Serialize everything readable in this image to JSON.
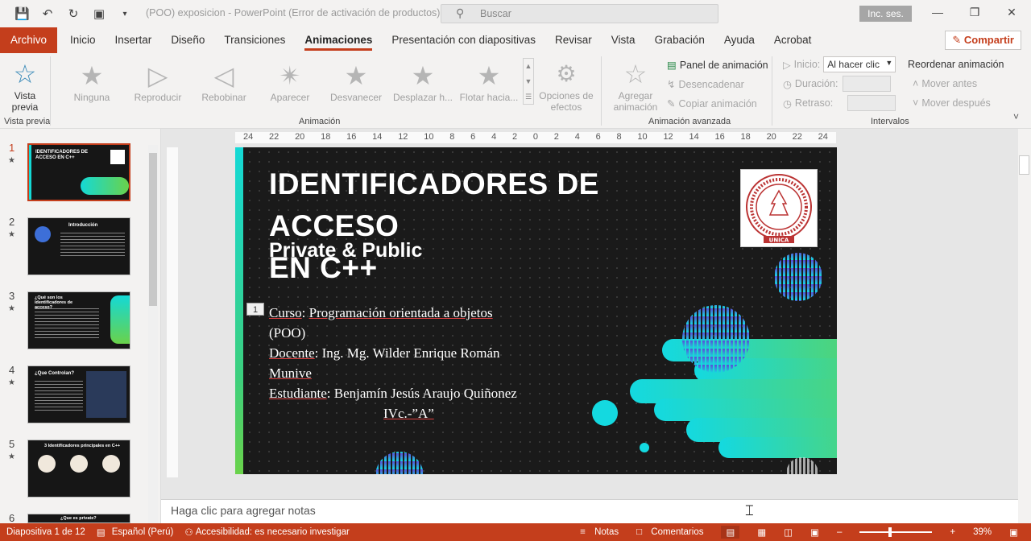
{
  "titlebar": {
    "doc_title": "(POO) exposicion  -  PowerPoint (Error de activación de productos)",
    "search_placeholder": "Buscar",
    "signin": "Inc. ses."
  },
  "tabs": [
    "Archivo",
    "Inicio",
    "Insertar",
    "Diseño",
    "Transiciones",
    "Animaciones",
    "Presentación con diapositivas",
    "Revisar",
    "Vista",
    "Grabación",
    "Ayuda",
    "Acrobat"
  ],
  "active_tab": "Animaciones",
  "share_label": "Compartir",
  "ribbon": {
    "preview": {
      "label1": "Vista",
      "label2": "previa",
      "group": "Vista previa"
    },
    "animations": [
      {
        "label": "Ninguna",
        "icon": "star-icon"
      },
      {
        "label": "Reproducir",
        "icon": "play-icon"
      },
      {
        "label": "Rebobinar",
        "icon": "rewind-icon"
      },
      {
        "label": "Aparecer",
        "icon": "appear-star-icon"
      },
      {
        "label": "Desvanecer",
        "icon": "fade-star-icon"
      },
      {
        "label": "Desplazar h...",
        "icon": "fly-star-icon"
      },
      {
        "label": "Flotar hacia...",
        "icon": "float-star-icon"
      }
    ],
    "effect_options": {
      "label1": "Opciones de",
      "label2": "efectos"
    },
    "animation_group": "Animación",
    "add_animation": {
      "label1": "Agregar",
      "label2": "animación"
    },
    "advanced": {
      "panel": "Panel de animación",
      "trigger": "Desencadenar",
      "copy": "Copiar animación",
      "group": "Animación avanzada"
    },
    "timing": {
      "start_label": "Inicio:",
      "start_value": "Al hacer clic",
      "duration_label": "Duración:",
      "delay_label": "Retraso:",
      "reorder": "Reordenar animación",
      "move_earlier": "Mover antes",
      "move_later": "Mover después",
      "group": "Intervalos"
    }
  },
  "ruler_h": [
    "24",
    "22",
    "20",
    "18",
    "16",
    "14",
    "12",
    "10",
    "8",
    "6",
    "4",
    "2",
    "0",
    "2",
    "4",
    "6",
    "8",
    "10",
    "12",
    "14",
    "16",
    "18",
    "20",
    "22",
    "24"
  ],
  "thumbnails": [
    {
      "num": "1",
      "title": "IDENTIFICADORES DE ACCESO EN C++"
    },
    {
      "num": "2",
      "title": "Introducción"
    },
    {
      "num": "3",
      "title": "¿Qué son los identificadores de acceso?"
    },
    {
      "num": "4",
      "title": "¿Que Controlan?"
    },
    {
      "num": "5",
      "title": "3 Identificadores principales en C++"
    },
    {
      "num": "6",
      "title": "¿Que es private?"
    }
  ],
  "slide": {
    "title_line1": "IDENTIFICADORES DE ACCESO",
    "title_line2": "EN C++",
    "subtitle": "Private & Public",
    "anim_tag": "1",
    "course_label": "Curso",
    "course_value": "Programación orientada a objetos",
    "course_cont": "(POO)",
    "teacher_label": "Docente",
    "teacher_value": ": Ing. Mg. Wilder Enrique Román",
    "teacher_cont": "Munive",
    "student_label": "Estudiante",
    "student_value": ": Benjamín Jesús Araujo Quiñonez",
    "group": "IVc.-”A”",
    "seal_text": "UNICA"
  },
  "notes_placeholder": "Haga clic para agregar notas",
  "status": {
    "slide_info": "Diapositiva 1 de 12",
    "language": "Español (Perú)",
    "accessibility": "Accesibilidad: es necesario investigar",
    "notes": "Notas",
    "comments": "Comentarios",
    "zoom": "39%"
  },
  "colors": {
    "accent": "#c43e1c",
    "slide_bg": "#1a1a1a",
    "teal": "#14d9d6",
    "green": "#6ad24a"
  }
}
